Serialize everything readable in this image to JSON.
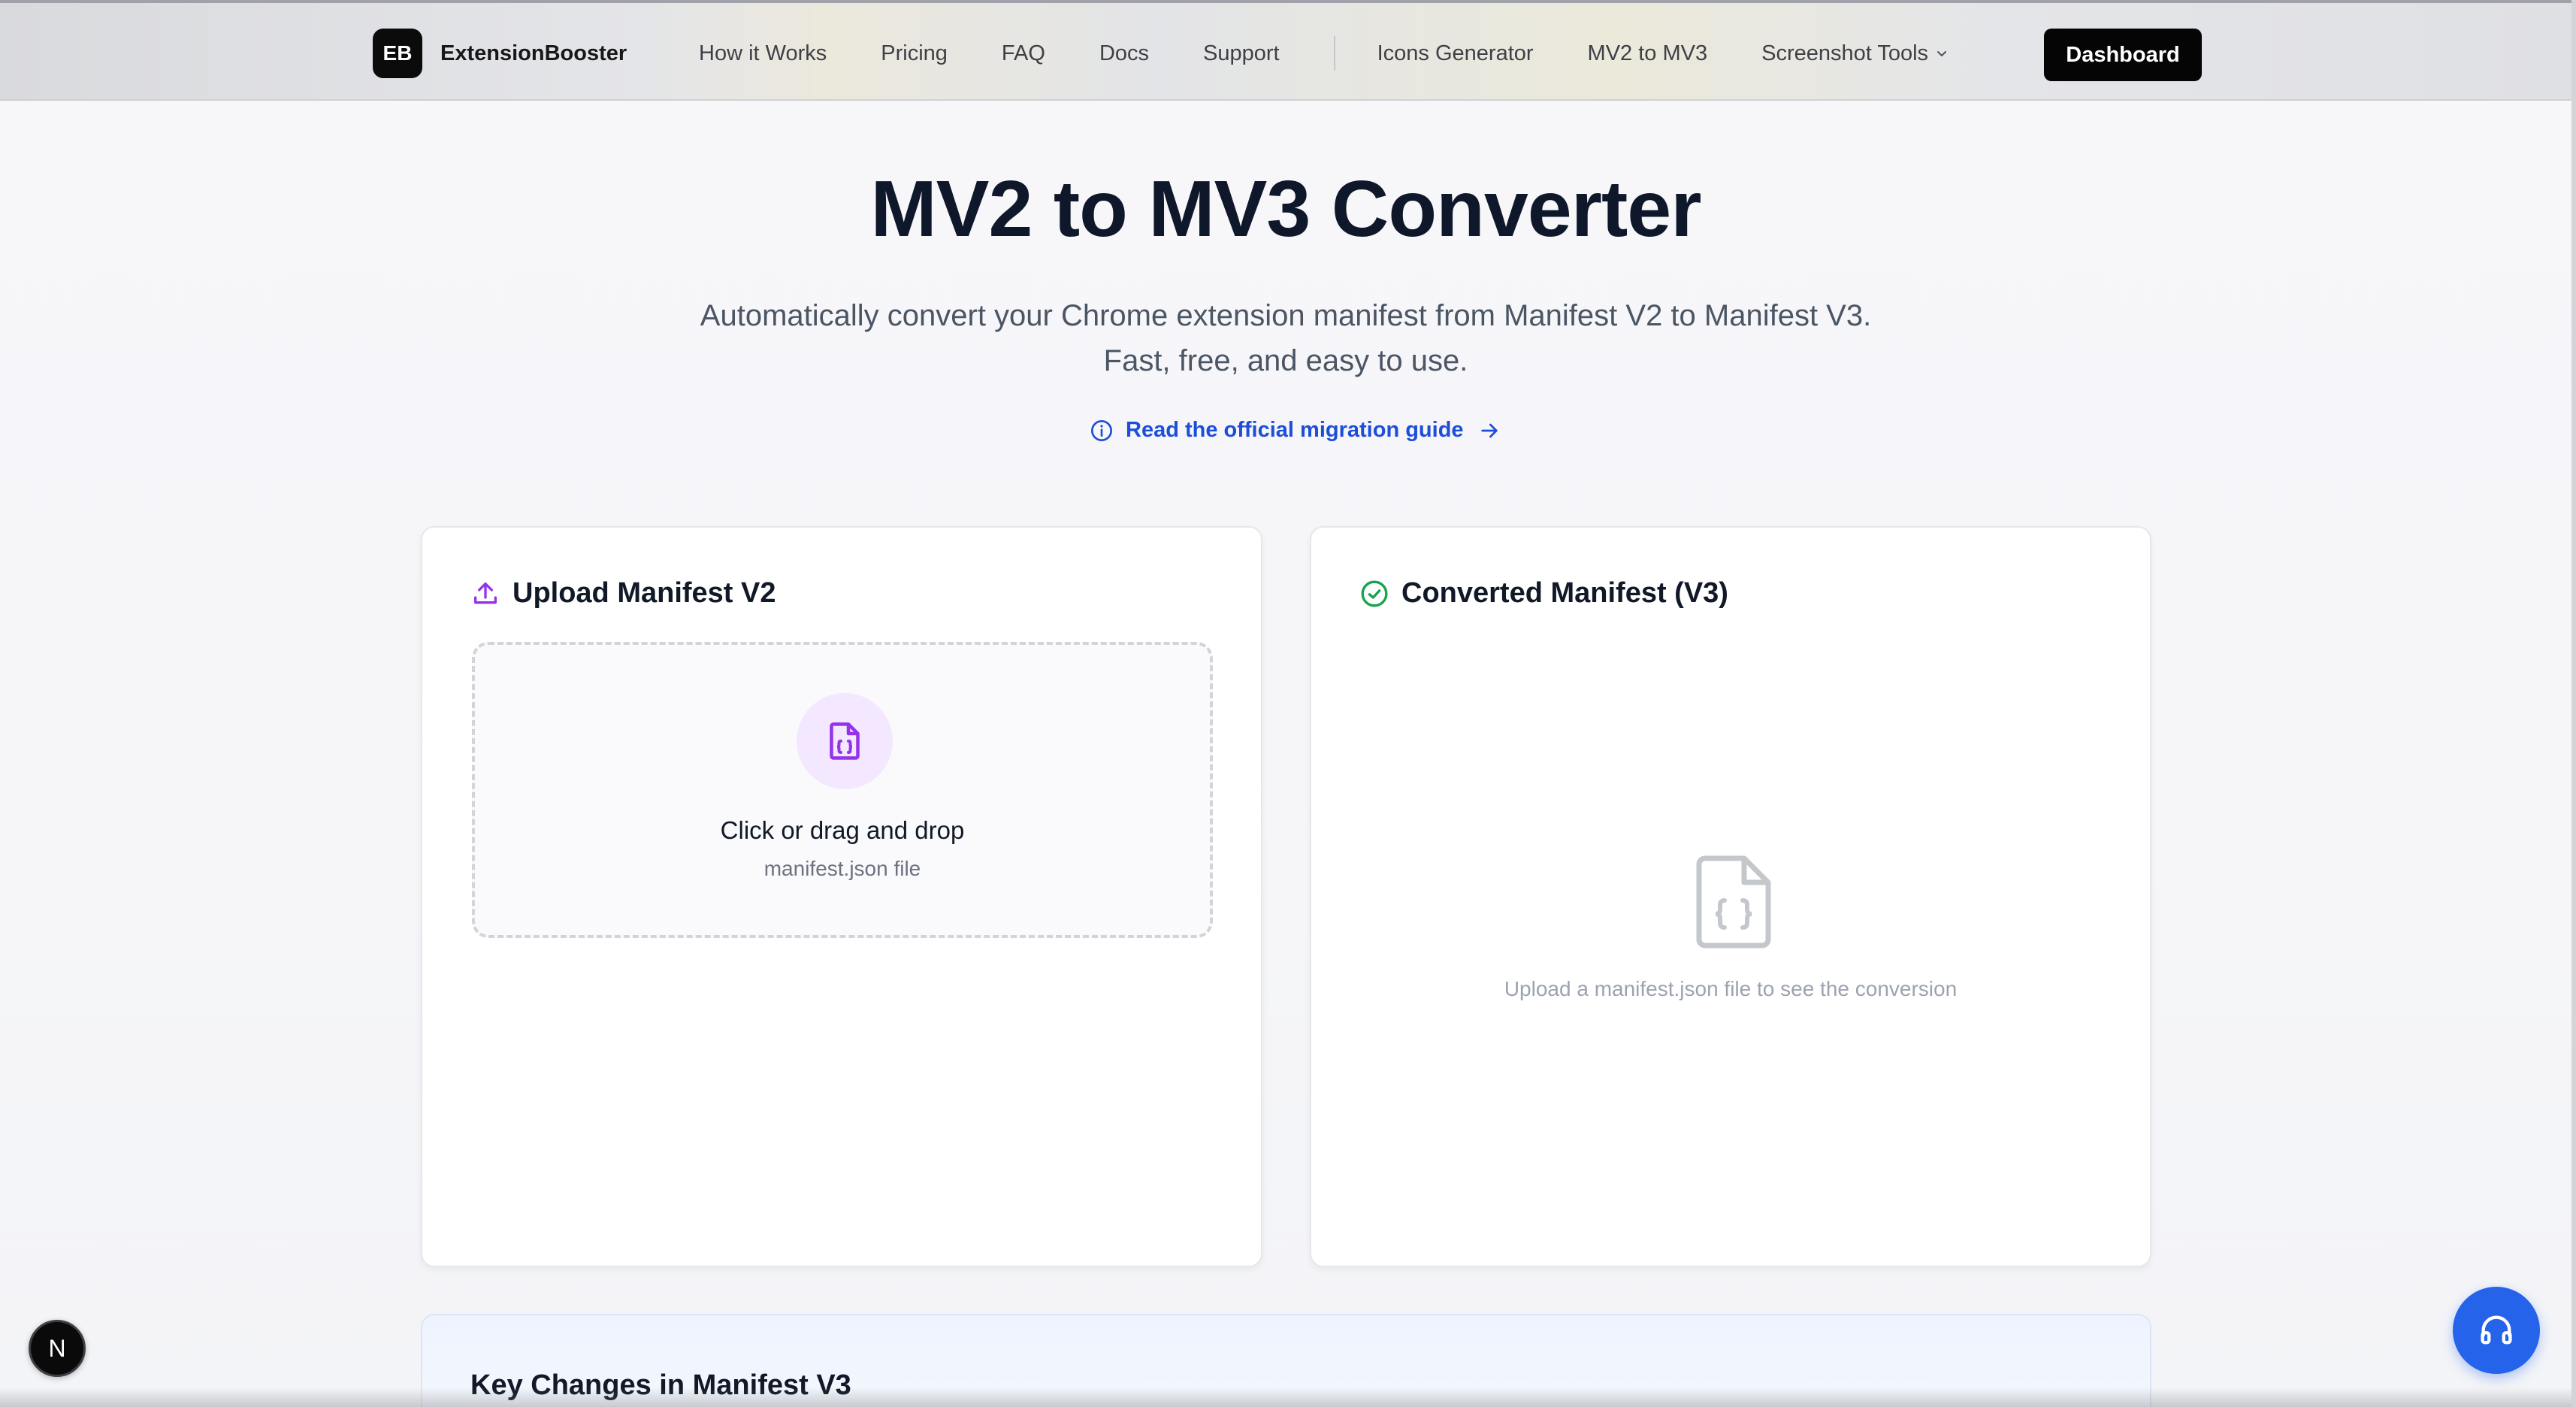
{
  "navbar": {
    "logo_text": "EB",
    "brand_name": "ExtensionBooster",
    "links": [
      {
        "label": "How it Works"
      },
      {
        "label": "Pricing"
      },
      {
        "label": "FAQ"
      },
      {
        "label": "Docs"
      },
      {
        "label": "Support"
      }
    ],
    "tools": [
      {
        "label": "Icons Generator"
      },
      {
        "label": "MV2 to MV3"
      },
      {
        "label": "Screenshot Tools",
        "icon": "chevron-down-icon"
      }
    ],
    "dashboard_label": "Dashboard"
  },
  "hero": {
    "title": "MV2 to MV3 Converter",
    "subtitle_line1": "Automatically convert your Chrome extension manifest from Manifest V2 to Manifest V3.",
    "subtitle_line2": "Fast, free, and easy to use.",
    "guide_link": "Read the official migration guide"
  },
  "upload_card": {
    "title": "Upload Manifest V2",
    "icon": "upload-icon",
    "dropzone_title": "Click or drag and drop",
    "dropzone_sub": "manifest.json file"
  },
  "converted_card": {
    "title": "Converted Manifest (V3)",
    "icon": "check-circle-icon",
    "empty_text": "Upload a manifest.json file to see the conversion"
  },
  "key_changes": {
    "title": "Key Changes in Manifest V3"
  },
  "floating": {
    "next_badge": "N",
    "support_icon": "headphones-icon"
  },
  "colors": {
    "accent_purple": "#9333ea",
    "link_blue": "#1d4ed8",
    "success_green": "#16a34a",
    "support_blue": "#2563eb"
  }
}
